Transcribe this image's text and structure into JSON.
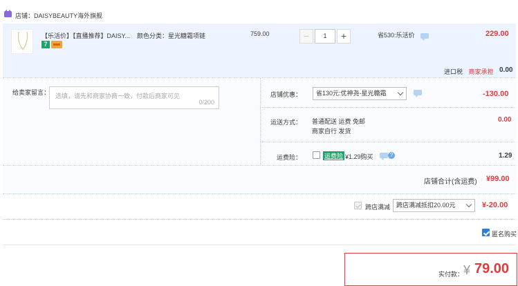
{
  "shop": {
    "icon": "shop-icon",
    "label": "店铺：DAISYBEAUTY海外旗舰"
  },
  "item": {
    "thumb_icon": "necklace-thumbnail",
    "title": "【乐活价】【直播推荐】DAISY...",
    "badge_icons": [
      "seven-day-return-icon",
      "card-payment-icon"
    ],
    "badge_seven": "7",
    "sku": "颜色分类：星光糖霜项链",
    "unit_price": "759.00",
    "quantity": "1",
    "minus": "−",
    "plus": "+",
    "saving": "省530:乐活价",
    "total": "229.00"
  },
  "tax": {
    "label": "进口税",
    "link": "商家承担",
    "value": "0.00"
  },
  "message": {
    "label": "给卖家留言：",
    "placeholder": "选填，请先和商家协商一致，付款后商家可见",
    "counter": "0/200"
  },
  "discount": {
    "label": "店铺优惠：",
    "selected": "省130元:优神尧-星光糖霜",
    "value": "-130.00"
  },
  "shipping": {
    "label": "运送方式：",
    "line1": "普通配送 运费 免邮",
    "line2": "商家自行  发货",
    "value": "0.00"
  },
  "insurance": {
    "label": "运费险：",
    "badge": "运费险",
    "text": "¥1.29购买",
    "help": "?",
    "value": "1.29"
  },
  "shop_total": {
    "label": "店铺合计(含运费)",
    "value": "¥99.00"
  },
  "cross_store": {
    "label": "跨店满减",
    "selected": "跨店满减抵扣20.00元",
    "value": "¥-20.00"
  },
  "anonymous": {
    "label": "匿名购买",
    "checked": true
  },
  "payment": {
    "label": "实付款：",
    "currency": "¥",
    "amount": "79.00"
  },
  "colors": {
    "accent_red": "#e4393c",
    "link_blue": "#2e7de1",
    "row_bg": "#eef4ff",
    "border_blue": "#b2d1ff"
  }
}
